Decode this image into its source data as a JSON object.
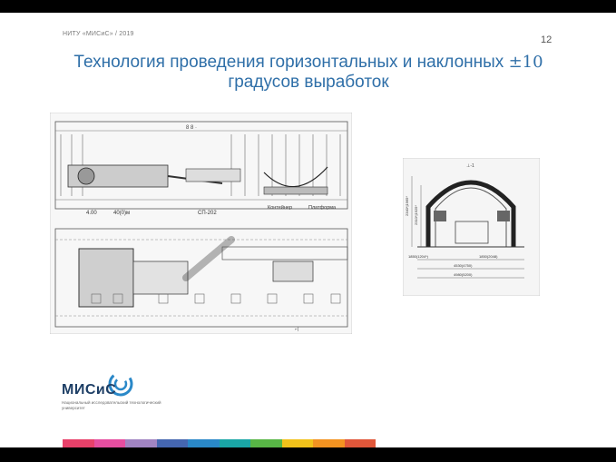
{
  "header": {
    "org_label": "НИТУ «МИСиС» / 2019",
    "page_number": "12"
  },
  "title": {
    "line1": "Технология проведения горизонтальных и наклонных ",
    "pm": "±10",
    "line2": "градусов выработок"
  },
  "figure_left": {
    "labels": {
      "dim_top": "8 8 ·",
      "label_a": "4.00",
      "label_b": "40(0)м",
      "label_c": "СП-202",
      "label_d": "Контейнер",
      "label_e": "Платформа",
      "label_f": "⌐|"
    }
  },
  "figure_right": {
    "labels": {
      "top": "⊥-1",
      "left1": "2340*|1965*",
      "left2": "2310*|1925*",
      "dim1": "1850(1204*)",
      "dim2": "4530(4750)",
      "dim3": "4980(5200)",
      "dim4": "1850(2048)"
    }
  },
  "logo": {
    "name": "МИСиС",
    "subtitle": "Национальный исследовательский технологический университет"
  },
  "stripe_colors": [
    "#e8416a",
    "#e64ea0",
    "#a184c2",
    "#4566b0",
    "#2a88c8",
    "#1aa6a6",
    "#58b646",
    "#f2c21b",
    "#f39321",
    "#e0573a"
  ]
}
